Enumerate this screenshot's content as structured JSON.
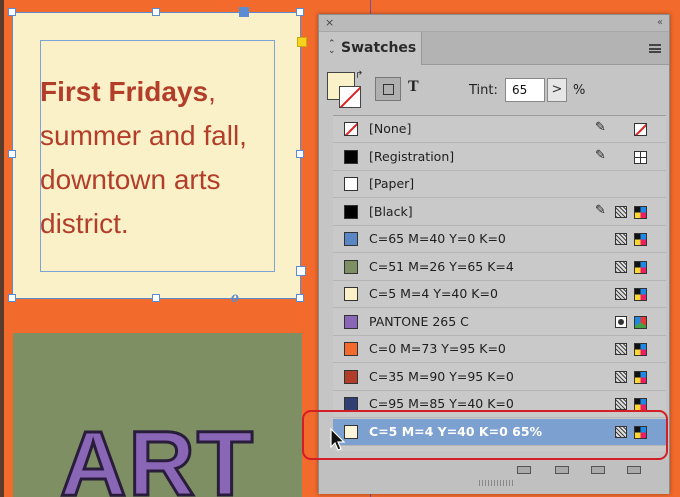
{
  "document": {
    "headline_bold": "First Fridays",
    "headline_comma": ",",
    "headline_line2": "summer and fall,",
    "headline_line3": "downtown arts",
    "headline_line4": "district.",
    "art_text": "ART",
    "link_glyph": "o"
  },
  "panel": {
    "close_glyph": "×",
    "collapse_glyph": "‹‹",
    "tab_label": "Swatches",
    "tab_arrows": "⌃⌄",
    "format_text_glyph": "T",
    "tint_label": "Tint:",
    "tint_value": "65",
    "tint_arrow": ">",
    "tint_unit": "%"
  },
  "swatches": [
    {
      "name": "[None]",
      "color": "none",
      "pencil": true,
      "mode": "",
      "ctype": "none-ic"
    },
    {
      "name": "[Registration]",
      "color": "#000000",
      "pencil": true,
      "mode": "",
      "ctype": "reg"
    },
    {
      "name": "[Paper]",
      "color": "#ffffff",
      "pencil": false,
      "mode": "",
      "ctype": ""
    },
    {
      "name": "[Black]",
      "color": "#000000",
      "pencil": true,
      "mode": "process",
      "ctype": "cmyk"
    },
    {
      "name": "C=65 M=40 Y=0 K=0",
      "color": "#5b86c6",
      "pencil": false,
      "mode": "process",
      "ctype": "cmyk"
    },
    {
      "name": "C=51 M=26 Y=65 K=4",
      "color": "#7e8f64",
      "pencil": false,
      "mode": "process",
      "ctype": "cmyk"
    },
    {
      "name": "C=5 M=4 Y=40 K=0",
      "color": "#fbf1c8",
      "pencil": false,
      "mode": "process",
      "ctype": "cmyk"
    },
    {
      "name": "PANTONE 265 C",
      "color": "#8a66b6",
      "pencil": false,
      "mode": "spot",
      "ctype": "rgb"
    },
    {
      "name": "C=0 M=73 Y=95 K=0",
      "color": "#f26a2c",
      "pencil": false,
      "mode": "process",
      "ctype": "cmyk"
    },
    {
      "name": "C=35 M=90 Y=95 K=0",
      "color": "#b23e2a",
      "pencil": false,
      "mode": "process",
      "ctype": "cmyk"
    },
    {
      "name": "C=95 M=85 Y=40 K=0",
      "color": "#2f3f73",
      "pencil": false,
      "mode": "process",
      "ctype": "cmyk"
    },
    {
      "name": "C=5 M=4 Y=40 K=0 65%",
      "color": "#fcf5d9",
      "pencil": false,
      "mode": "process",
      "ctype": "cmyk",
      "selected": true
    }
  ],
  "colors": {
    "orange": "#f26a2c",
    "cream": "#fbf1c8",
    "headline_red": "#b23e2a",
    "olive": "#7e8f64",
    "purple": "#8a66b6",
    "selection_blue": "#7ca0cf",
    "highlight_red": "#d21f26"
  },
  "icons": [
    "close-icon",
    "collapse-icon",
    "panel-menu-icon",
    "edit-pencil-icon",
    "process-mode-icon",
    "spot-mode-icon",
    "cmyk-icon",
    "rgb-icon",
    "registration-icon",
    "none-icon",
    "mouse-cursor-icon"
  ]
}
